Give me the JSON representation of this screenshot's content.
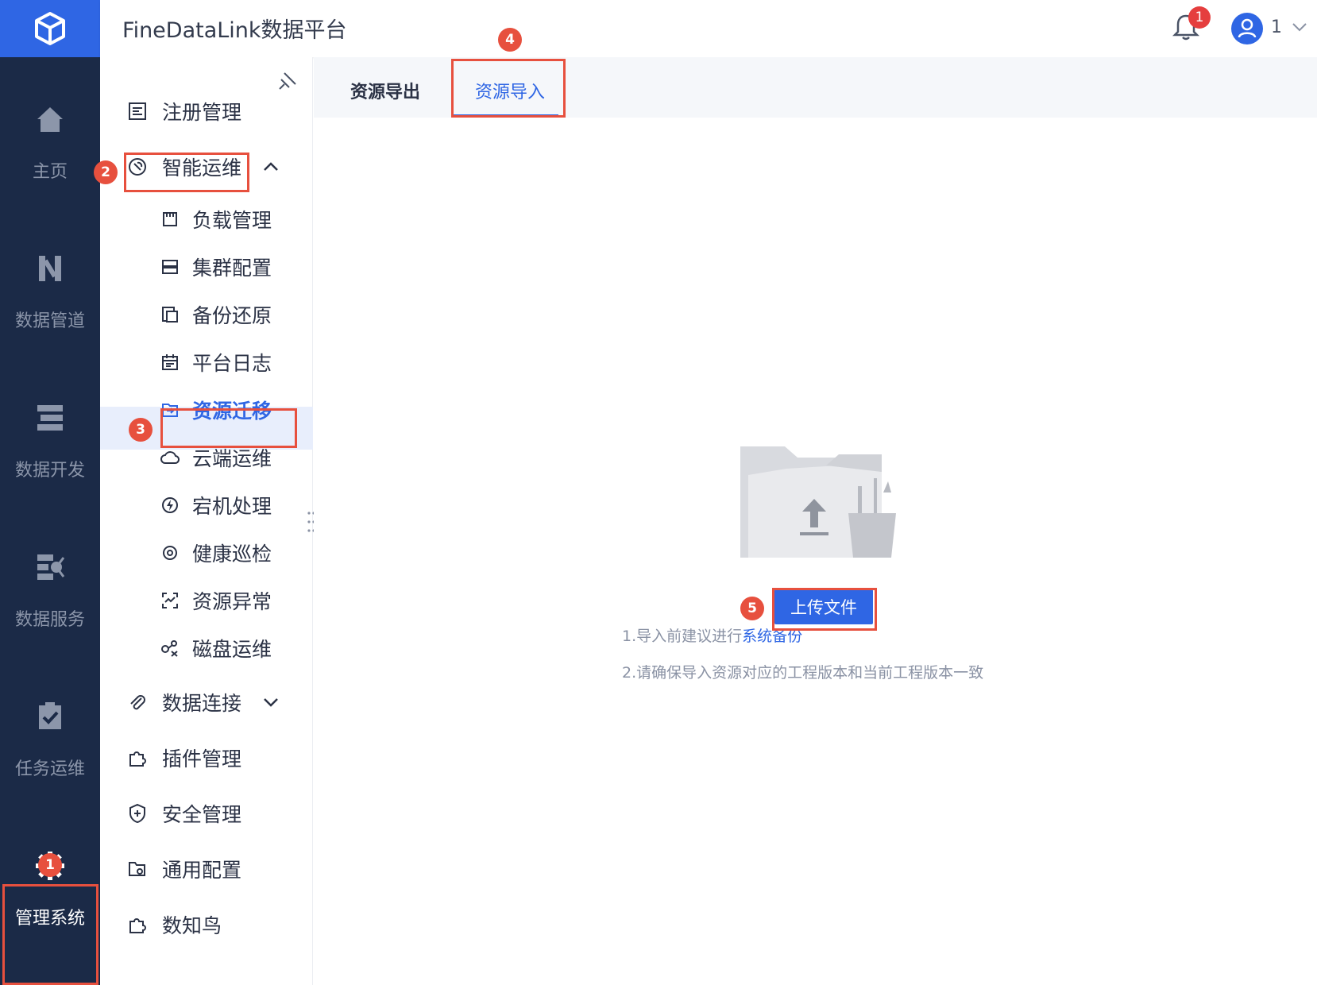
{
  "header": {
    "app_title": "FineDataLink数据平台",
    "notification_count": "1",
    "user_name": "1"
  },
  "rail": {
    "items": [
      {
        "label": "主页",
        "icon": "home-icon"
      },
      {
        "label": "数据管道",
        "icon": "pipeline-icon"
      },
      {
        "label": "数据开发",
        "icon": "dev-icon"
      },
      {
        "label": "数据服务",
        "icon": "service-icon"
      },
      {
        "label": "任务运维",
        "icon": "task-check-icon"
      },
      {
        "label": "管理系统",
        "icon": "gear-icon"
      }
    ]
  },
  "sidebar": {
    "items": [
      {
        "label": "注册管理"
      },
      {
        "label": "智能运维"
      },
      {
        "label": "负载管理"
      },
      {
        "label": "集群配置"
      },
      {
        "label": "备份还原"
      },
      {
        "label": "平台日志"
      },
      {
        "label": "资源迁移"
      },
      {
        "label": "云端运维"
      },
      {
        "label": "宕机处理"
      },
      {
        "label": "健康巡检"
      },
      {
        "label": "资源异常"
      },
      {
        "label": "磁盘运维"
      },
      {
        "label": "数据连接"
      },
      {
        "label": "插件管理"
      },
      {
        "label": "安全管理"
      },
      {
        "label": "通用配置"
      },
      {
        "label": "数知鸟"
      }
    ]
  },
  "tabs": [
    {
      "label": "资源导出"
    },
    {
      "label": "资源导入"
    }
  ],
  "main": {
    "upload_button": "上传文件",
    "hint1_prefix": "1.导入前建议进行",
    "hint1_link": "系统备份",
    "hint2": "2.请确保导入资源对应的工程版本和当前工程版本一致"
  },
  "annotations": [
    "1",
    "2",
    "3",
    "4",
    "5"
  ],
  "colors": {
    "accent": "#2f66e4",
    "rail_bg": "#1b2a47",
    "annotation": "#e7503e"
  }
}
